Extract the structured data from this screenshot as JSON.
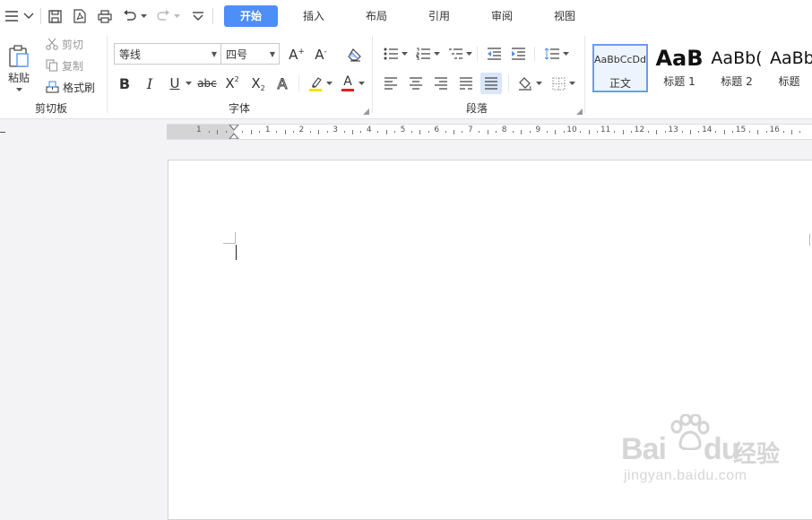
{
  "tabs": [
    {
      "label": "开始",
      "active": true
    },
    {
      "label": "插入",
      "active": false
    },
    {
      "label": "布局",
      "active": false
    },
    {
      "label": "引用",
      "active": false
    },
    {
      "label": "审阅",
      "active": false
    },
    {
      "label": "视图",
      "active": false
    }
  ],
  "clipboard": {
    "paste_label": "粘贴",
    "cut_label": "剪切",
    "copy_label": "复制",
    "format_painter_label": "格式刷",
    "group_label": "剪切板"
  },
  "font": {
    "family_value": "等线",
    "size_value": "四号",
    "group_label": "字体",
    "grow_label": "A",
    "shrink_label": "A",
    "bold_label": "B",
    "italic_label": "I",
    "underline_label": "U",
    "strike_label": "abc",
    "superscript_label": "X",
    "subscript_label": "X",
    "effect_label": "A",
    "color_label": "A"
  },
  "paragraph": {
    "group_label": "段落"
  },
  "styles": [
    {
      "sample": "AaBbCcDd",
      "name": "正文",
      "selected": true
    },
    {
      "sample": "AaB",
      "name": "标题 1",
      "selected": false
    },
    {
      "sample": "AaBb(",
      "name": "标题 2",
      "selected": false
    },
    {
      "sample": "AaBb",
      "name": "标题",
      "selected": false
    }
  ],
  "ruler": {
    "left_numbers": [
      "1"
    ],
    "numbers": [
      "1",
      "2",
      "3",
      "4",
      "5",
      "6",
      "7",
      "8",
      "9",
      "10",
      "11",
      "12",
      "13",
      "14",
      "15",
      "16"
    ]
  },
  "watermark": {
    "brand": "Bai",
    "brand2": "du",
    "suffix": "经验",
    "url": "jingyan.baidu.com"
  },
  "colors": {
    "accent": "#4e8ef7",
    "highlight": "#f5e300",
    "font_color": "#e02020"
  }
}
